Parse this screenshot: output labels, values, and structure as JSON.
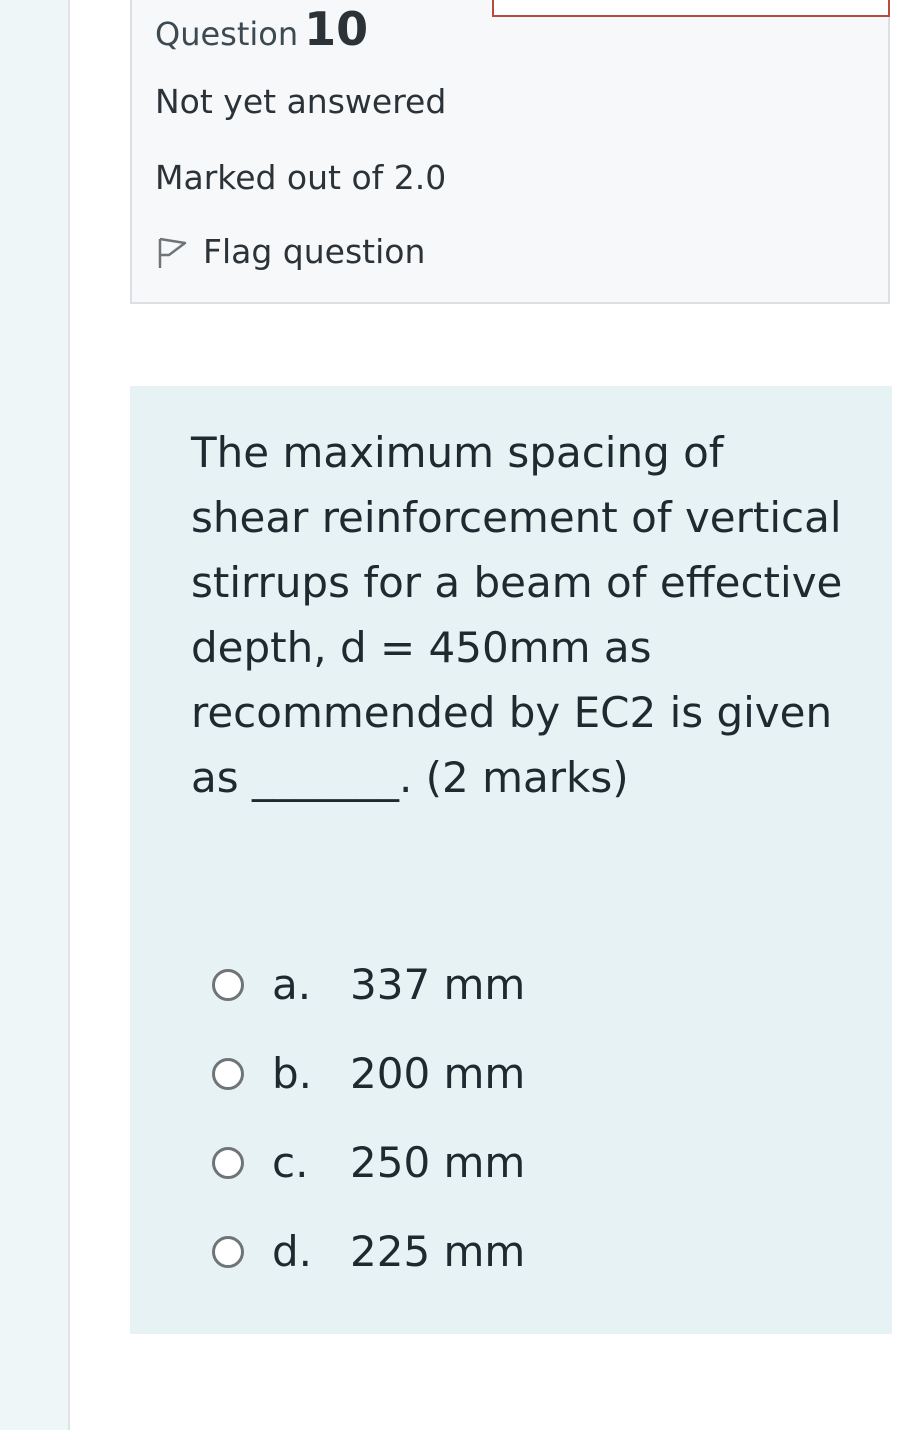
{
  "question": {
    "label": "Question",
    "number": "10",
    "status": "Not yet answered",
    "marks": "Marked out of 2.0",
    "flag_label": "Flag question",
    "flag_icon": "flag-outline-icon"
  },
  "question_text": "The maximum spacing of shear reinforcement of vertical stirrups for a beam of effective depth, d = 450mm as recommended by EC2 is given as _______. (2 marks)",
  "options": [
    {
      "letter": "a.",
      "text": "337 mm"
    },
    {
      "letter": "b.",
      "text": "200 mm"
    },
    {
      "letter": "c.",
      "text": "250 mm"
    },
    {
      "letter": "d.",
      "text": "225 mm"
    }
  ],
  "colors": {
    "info_bg": "#f7f8fa",
    "question_bg": "#e6f2f4",
    "left_strip": "#eef6f8",
    "accent_red": "#b84a3e"
  }
}
